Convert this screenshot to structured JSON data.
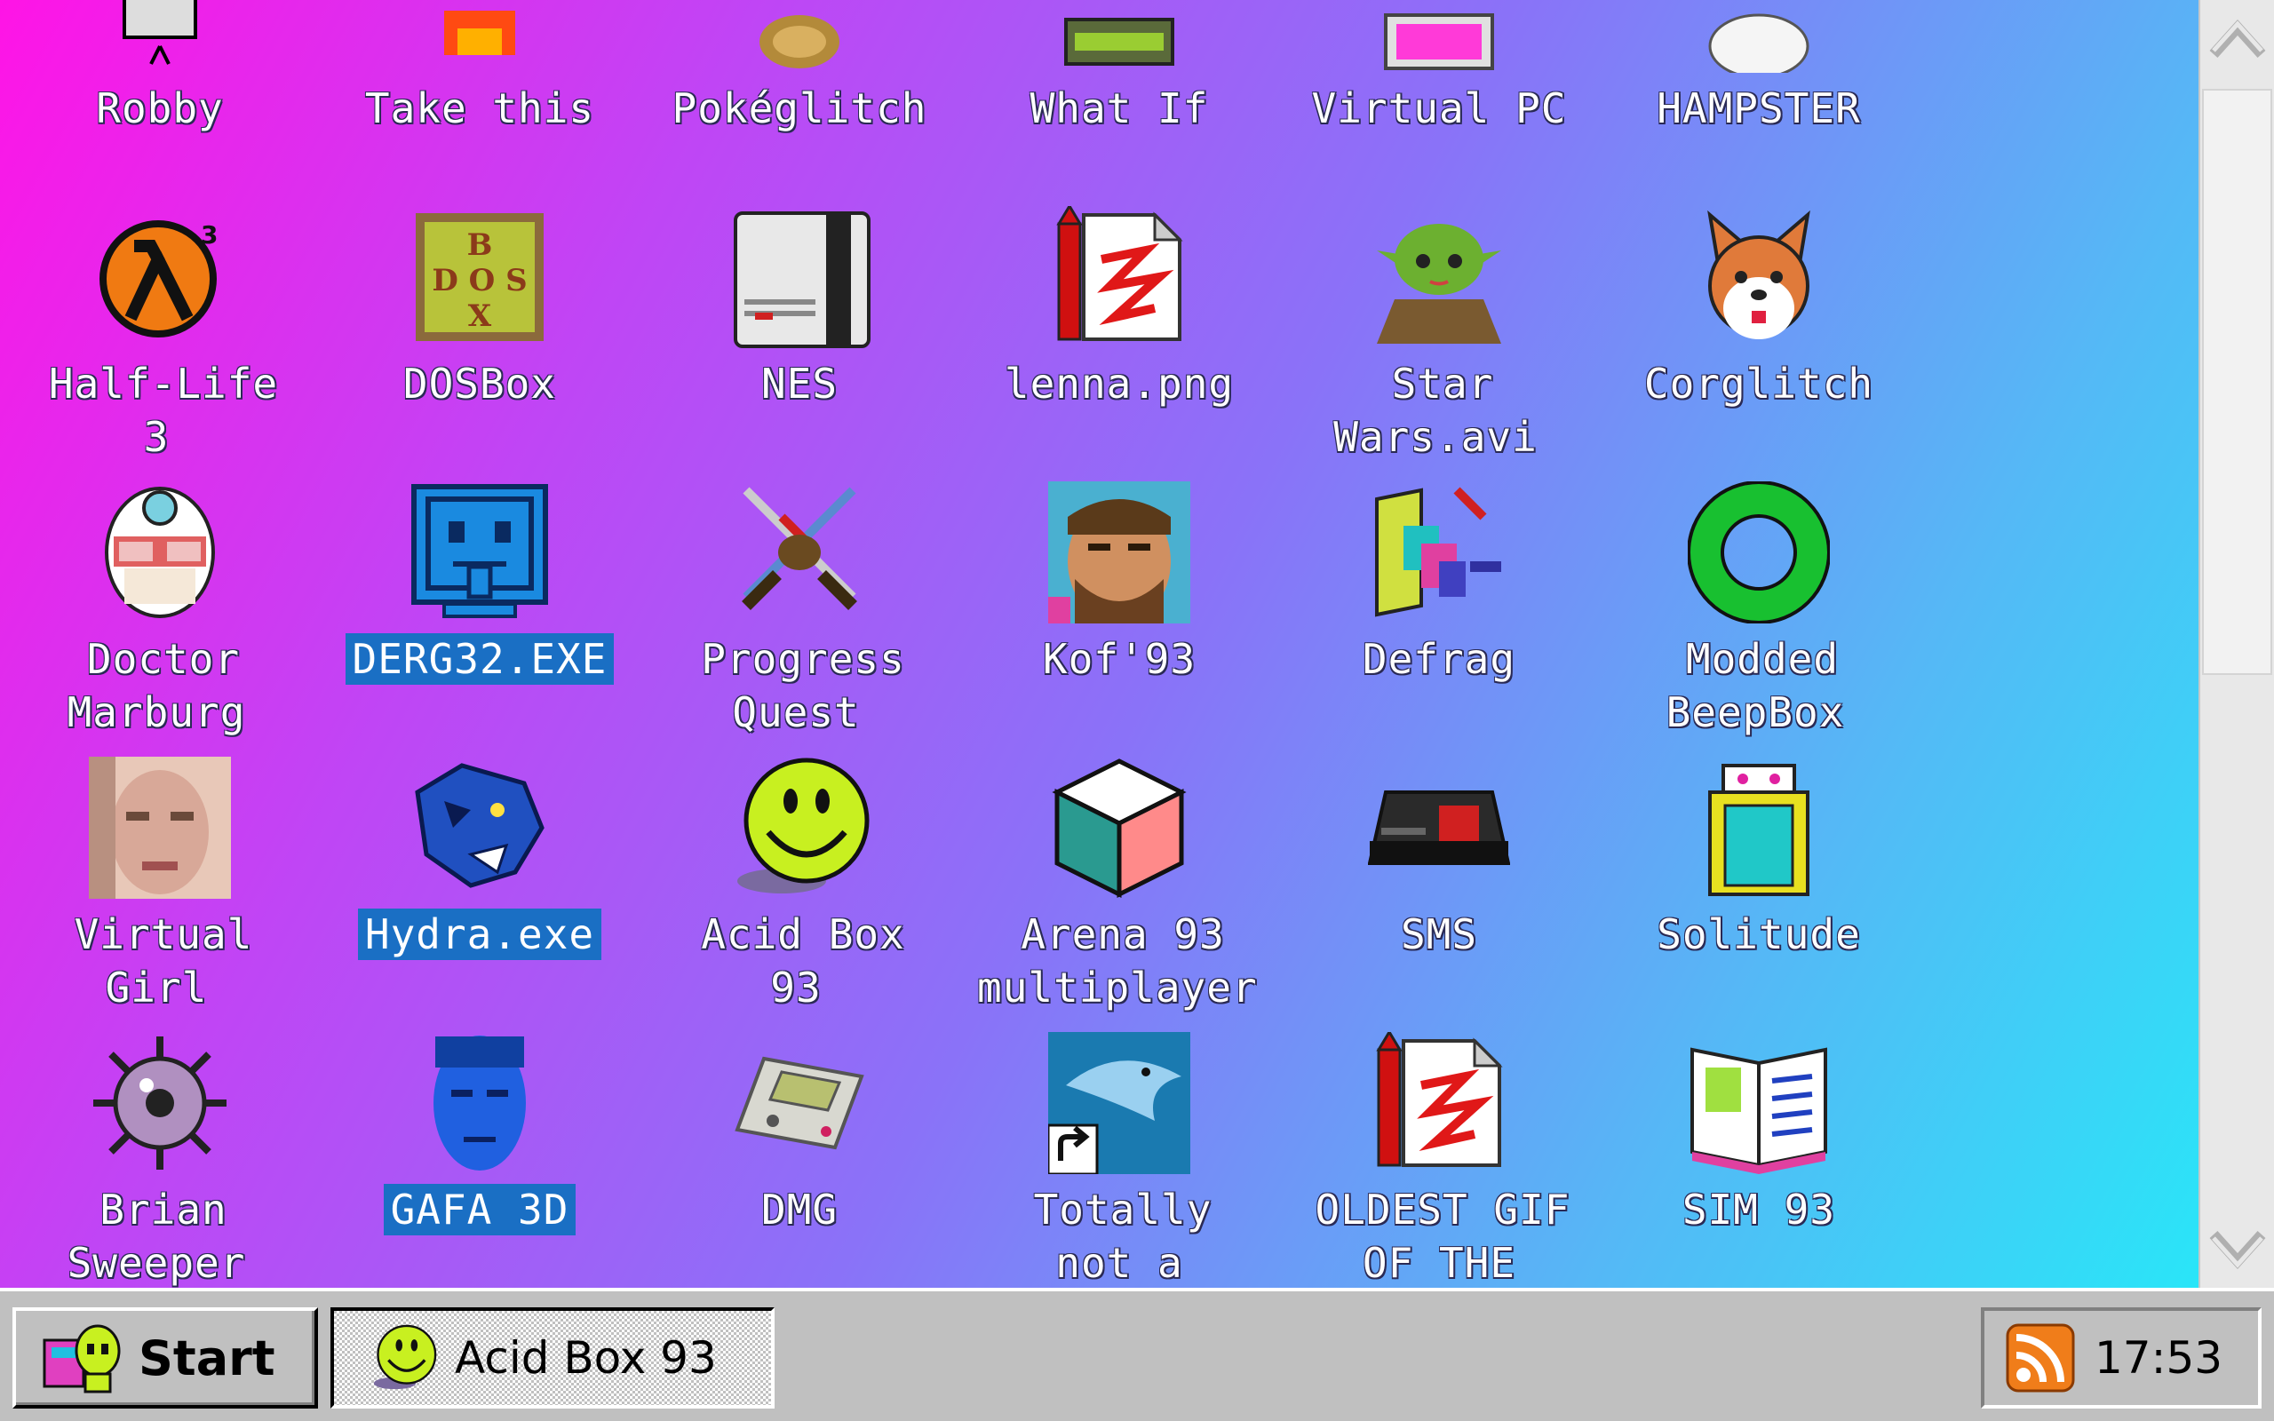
{
  "desktop": {
    "icons": [
      {
        "label": "Robby",
        "icon": "robot-icon"
      },
      {
        "label": "Take this",
        "icon": "sword-icon"
      },
      {
        "label": "Pokéglitch",
        "icon": "glitch-creature-icon"
      },
      {
        "label": "What If",
        "icon": "machine-icon"
      },
      {
        "label": "Virtual PC",
        "icon": "computer-icon"
      },
      {
        "label": "HAMPSTER",
        "icon": "hamster-icon"
      },
      {
        "label": "Half-Life 3",
        "icon": "half-life-lambda-icon"
      },
      {
        "label": "DOSBox",
        "icon": "dosbox-crate-icon"
      },
      {
        "label": "NES",
        "icon": "nes-console-icon"
      },
      {
        "label": "lenna.png",
        "icon": "paint-document-icon"
      },
      {
        "label": "Star Wars.avi",
        "icon": "yoda-icon"
      },
      {
        "label": "Corglitch",
        "icon": "corgi-icon"
      },
      {
        "label": "Doctor Marburg",
        "icon": "doctor-icon"
      },
      {
        "label": "DERG32.EXE",
        "icon": "monitor-face-icon",
        "selected": true
      },
      {
        "label": "Progress Quest",
        "icon": "crossed-swords-icon"
      },
      {
        "label": "Kof'93",
        "icon": "fighter-portrait-icon"
      },
      {
        "label": "Defrag",
        "icon": "defrag-icon"
      },
      {
        "label": "Modded BeepBox",
        "icon": "green-ring-icon"
      },
      {
        "label": "Virtual Girl",
        "icon": "girl-face-icon"
      },
      {
        "label": "Hydra.exe",
        "icon": "hydra-dragon-icon",
        "selected": true
      },
      {
        "label": "Acid Box 93",
        "icon": "acid-smiley-icon"
      },
      {
        "label": "Arena 93 multiplayer",
        "icon": "cube-icon"
      },
      {
        "label": "SMS",
        "icon": "sms-console-icon"
      },
      {
        "label": "Solitude",
        "icon": "solitude-card-icon"
      },
      {
        "label": "Brian Sweeper",
        "icon": "mine-icon"
      },
      {
        "label": "GAFA 3D",
        "icon": "blue-head-icon",
        "selected": true
      },
      {
        "label": "DMG",
        "icon": "gameboy-icon"
      },
      {
        "label": "Totally not a virus.Trust me... a",
        "icon": "dolphin-shortcut-icon"
      },
      {
        "label": "OLDEST GIF OF THE INTERWEBZ",
        "icon": "paint-document-icon"
      },
      {
        "label": "SIM 93",
        "icon": "open-book-icon"
      }
    ]
  },
  "scrollbar": {
    "up_icon": "chevron-up-icon",
    "down_icon": "chevron-down-icon"
  },
  "taskbar": {
    "start_label": "Start",
    "task_label": "Acid Box 93",
    "clock": "17:53",
    "tray_icon": "rss-feed-icon"
  },
  "colors": {
    "selection": "#1a6fc4",
    "taskbar": "#c0c0c0",
    "rss": "#f07d1a"
  }
}
